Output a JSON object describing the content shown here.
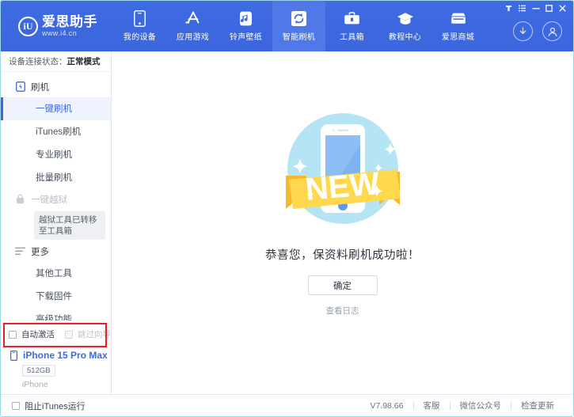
{
  "app": {
    "brand_name": "爱思助手",
    "brand_url": "www.i4.cn",
    "logo_glyph": "iU",
    "accent_color": "#3d6ae0",
    "header_bg": "#3f6be2",
    "highlight_color": "#ee1c25"
  },
  "window_controls": [
    {
      "name": "pin-icon",
      "label": ""
    },
    {
      "name": "menu-list-icon",
      "label": ""
    },
    {
      "name": "minimize-icon",
      "label": ""
    },
    {
      "name": "maximize-icon",
      "label": ""
    },
    {
      "name": "close-icon",
      "label": ""
    }
  ],
  "header": {
    "nav": [
      {
        "label": "我的设备",
        "icon": "phone-icon",
        "active": false
      },
      {
        "label": "应用游戏",
        "icon": "appstore-icon",
        "active": false
      },
      {
        "label": "铃声壁纸",
        "icon": "music-icon",
        "active": false
      },
      {
        "label": "智能刷机",
        "icon": "refresh-icon",
        "active": true
      },
      {
        "label": "工具箱",
        "icon": "toolbox-icon",
        "active": false
      },
      {
        "label": "教程中心",
        "icon": "graduation-cap-icon",
        "active": false
      },
      {
        "label": "爱思商城",
        "icon": "shop-icon",
        "active": false
      }
    ],
    "actions": [
      {
        "name": "download-button",
        "icon": "download-arrow-icon"
      },
      {
        "name": "account-button",
        "icon": "user-avatar-icon"
      }
    ]
  },
  "sidebar": {
    "connection_status_label": "设备连接状态：",
    "connection_status_value": "正常模式",
    "groups": [
      {
        "label": "刷机",
        "icon": "flash-device-icon",
        "disabled": false,
        "items": [
          {
            "label": "一键刷机",
            "active": true
          },
          {
            "label": "iTunes刷机",
            "active": false
          },
          {
            "label": "专业刷机",
            "active": false
          },
          {
            "label": "批量刷机",
            "active": false
          }
        ]
      },
      {
        "label": "一键越狱",
        "icon": "lock-icon",
        "disabled": true,
        "tip": "越狱工具已转移至工具箱",
        "items": []
      },
      {
        "label": "更多",
        "icon": "list-lines-icon",
        "disabled": false,
        "items": [
          {
            "label": "其他工具",
            "active": false
          },
          {
            "label": "下载固件",
            "active": false
          },
          {
            "label": "高级功能",
            "active": false
          }
        ]
      }
    ],
    "options": [
      {
        "label": "自动激活",
        "checked": false,
        "disabled": false
      },
      {
        "label": "跳过向导",
        "checked": false,
        "disabled": true
      }
    ],
    "device": {
      "name": "iPhone 15 Pro Max",
      "capacity": "512GB",
      "type": "iPhone",
      "icon": "phone-small-icon"
    }
  },
  "main": {
    "illustration": {
      "name": "new-phone-ribbon-illustration",
      "badge_text": "NEW",
      "circle_color": "#b5e4f5",
      "phone_body_color": "#ffffff",
      "screen_color": "#6ea8f0",
      "ribbon_color": "#ffd84d",
      "ribbon_shadow_color": "#f5b92a"
    },
    "headline": "恭喜您，保资料刷机成功啦！",
    "confirm_button": "确定",
    "log_link": "查看日志"
  },
  "footer": {
    "block_itunes_label": "阻止iTunes运行",
    "block_itunes_checked": false,
    "version": "V7.98.66",
    "links": [
      "客服",
      "微信公众号",
      "检查更新"
    ]
  }
}
